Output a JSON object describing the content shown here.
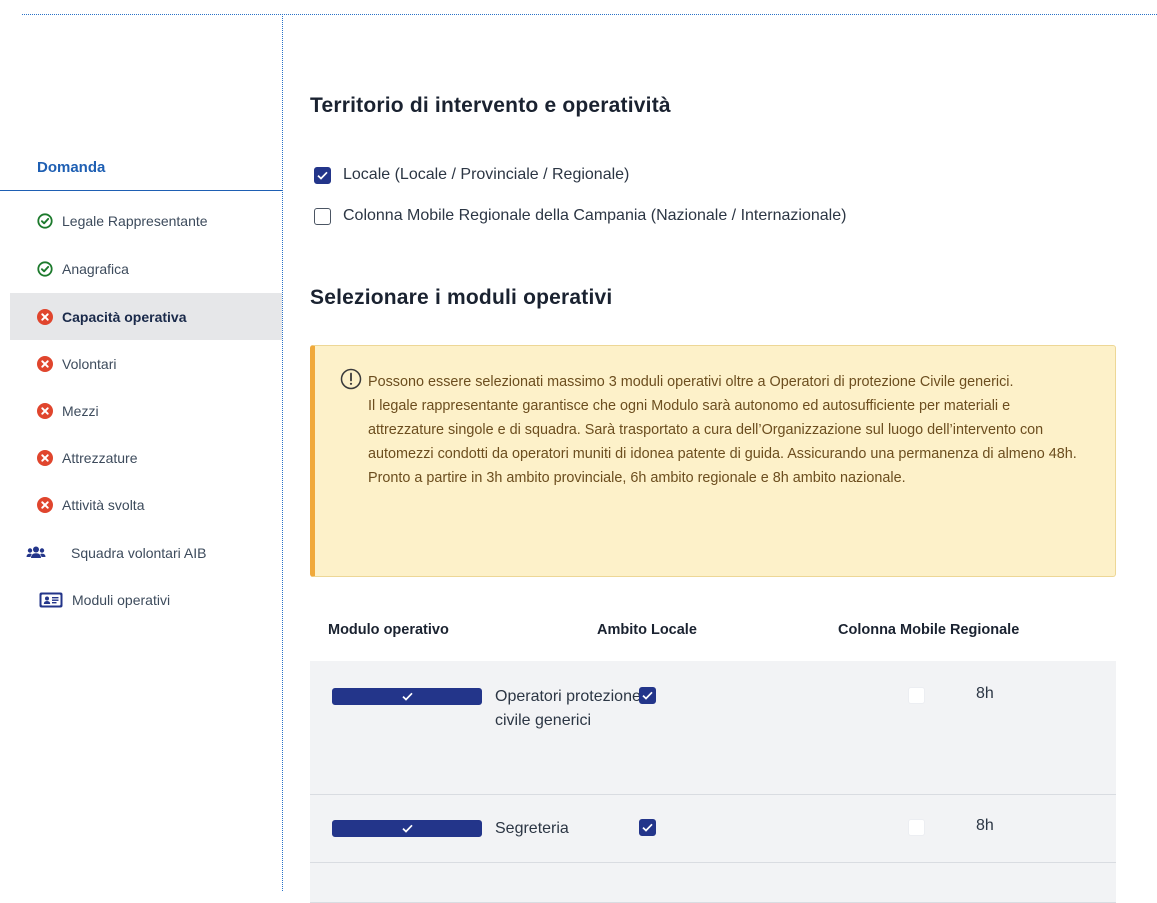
{
  "sidebar": {
    "header": "Domanda",
    "items": [
      {
        "label": "Legale Rappresentante",
        "icon": "check-circle-icon",
        "status": "complete"
      },
      {
        "label": "Anagrafica",
        "icon": "check-circle-icon",
        "status": "complete"
      },
      {
        "label": "Capacità operativa",
        "icon": "error-circle-icon",
        "status": "error",
        "active": true
      },
      {
        "label": "Volontari",
        "icon": "error-circle-icon",
        "status": "error"
      },
      {
        "label": "Mezzi",
        "icon": "error-circle-icon",
        "status": "error"
      },
      {
        "label": "Attrezzature",
        "icon": "error-circle-icon",
        "status": "error"
      },
      {
        "label": "Attività svolta",
        "icon": "error-circle-icon",
        "status": "error"
      },
      {
        "label": "Squadra volontari AIB",
        "icon": "users-icon"
      },
      {
        "label": "Moduli operativi",
        "icon": "id-card-icon"
      }
    ]
  },
  "territory": {
    "title": "Territorio di intervento e operatività",
    "options": [
      {
        "label": "Locale (Locale / Provinciale / Regionale)",
        "checked": true
      },
      {
        "label": "Colonna Mobile Regionale della Campania (Nazionale / Internazionale)",
        "checked": false
      }
    ]
  },
  "modules": {
    "title": "Selezionare i moduli operativi",
    "alert": {
      "icon": "info-exclamation-icon",
      "line1": "Possono essere selezionati massimo 3 moduli operativi oltre a Operatori di protezione Civile generici.",
      "line2": "Il legale rappresentante garantisce che ogni Modulo sarà autonomo ed autosufficiente per materiali e attrezzature singole e di squadra. Sarà trasportato a cura dell’Organizzazione sul luogo dell’intervento con automezzi condotti da operatori muniti di idonea patente di guida. Assicurando una permanenza di almeno 48h. Pronto a partire in 3h ambito provinciale, 6h ambito regionale e 8h ambito nazionale."
    },
    "table": {
      "headers": [
        "Modulo operativo",
        "Ambito Locale",
        "Colonna Mobile Regionale"
      ],
      "rows": [
        {
          "name": "Operatori protezione civile generici",
          "selected": true,
          "locale": true,
          "colonna": false,
          "hours": "8h"
        },
        {
          "name": "Segreteria",
          "selected": true,
          "locale": true,
          "colonna": false,
          "hours": "8h"
        }
      ]
    }
  },
  "colors": {
    "accent": "#1e5fb3",
    "checkbox": "#23358a",
    "success": "#1c7a2c",
    "error": "#e0452d",
    "alert_bg": "#fdf1c9",
    "alert_border": "#f0a93b"
  }
}
